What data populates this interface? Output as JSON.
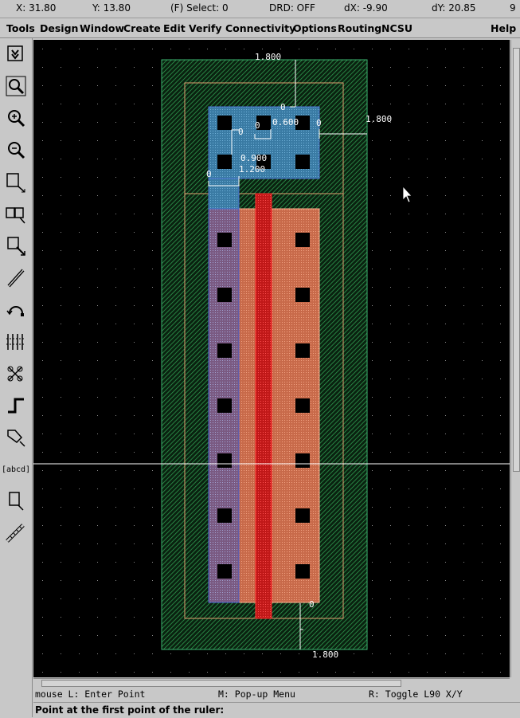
{
  "status": {
    "x": "X:  31.80",
    "y": "Y:  13.80",
    "select": "(F) Select: 0",
    "drd": "DRD: OFF",
    "dx": "dX: -9.90",
    "dy": "dY:  20.85",
    "window_num": "9"
  },
  "menu": {
    "items": [
      "Tools",
      "Design",
      "Window",
      "Create",
      "Edit",
      "Verify",
      "Connectivity",
      "Options",
      "Routing",
      "NCSU"
    ],
    "help": "Help"
  },
  "toolbar": {
    "abcd_label": "[abcd]",
    "tools": [
      "save-icon",
      "zoom-fit-icon",
      "zoom-in-icon",
      "zoom-out-icon",
      "stretch-icon",
      "copy-icon",
      "move-icon",
      "delete-icon",
      "undo-icon",
      "property-icon",
      "hierarchy-icon",
      "path-icon",
      "polygon-icon",
      "label-icon",
      "rectangle-icon",
      "ruler-icon"
    ]
  },
  "layout": {
    "rulers": {
      "top": "1.800",
      "right": "1.800",
      "bottom": "1.800",
      "contact_width": "0.600",
      "contact_spacing": "0.900",
      "poly_enclosure": "1.200",
      "zero_labels": [
        "0",
        "0",
        "0",
        "0",
        "0",
        "0"
      ]
    },
    "colors": {
      "background": "#000000",
      "nwell": "#3cb371",
      "active_border": "#e07a5f",
      "pdiff": "#d97a5a",
      "poly": "#d02020",
      "metal1": "#3c7ca8",
      "contact": "#000000",
      "ruler": "#ffffff",
      "crosshair": "#ffffff"
    }
  },
  "mouse_bar": {
    "left": "mouse L: Enter Point",
    "middle": "M: Pop-up Menu",
    "right": "R: Toggle L90 X/Y"
  },
  "prompt": "Point at the first point of the ruler:"
}
